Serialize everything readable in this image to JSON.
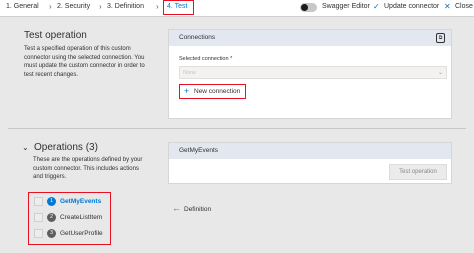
{
  "nav": {
    "steps": [
      {
        "label": "1. General"
      },
      {
        "label": "2. Security"
      },
      {
        "label": "3. Definition"
      },
      {
        "label": "4. Test"
      }
    ],
    "swagger_editor_label": "Swagger Editor",
    "update_connector_label": "Update connector",
    "close_label": "Close"
  },
  "test_section": {
    "title": "Test operation",
    "description": "Test a specified operation of this custom connector using the selected connection. You must update the custom connector in order to test recent changes.",
    "connections_card": {
      "title": "Connections",
      "selected_connection_label": "Selected connection *",
      "selected_connection_value": "None",
      "new_connection_label": "New connection"
    }
  },
  "operations_section": {
    "title": "Operations (3)",
    "description": "These are the operations defined by your custom connector. This includes actions and triggers.",
    "operations": [
      {
        "number": "1",
        "name": "GetMyEvents",
        "active": true
      },
      {
        "number": "2",
        "name": "CreateListItem",
        "active": false
      },
      {
        "number": "3",
        "name": "GetUserProfile",
        "active": false
      }
    ],
    "selected_operation": {
      "title": "GetMyEvents",
      "test_button_label": "Test operation"
    },
    "definition_link_label": "Definition"
  },
  "colors": {
    "accent": "#0078d4",
    "highlight": "#e81123",
    "card_header": "#e2e7f0",
    "page_background": "#e8e8e8"
  }
}
